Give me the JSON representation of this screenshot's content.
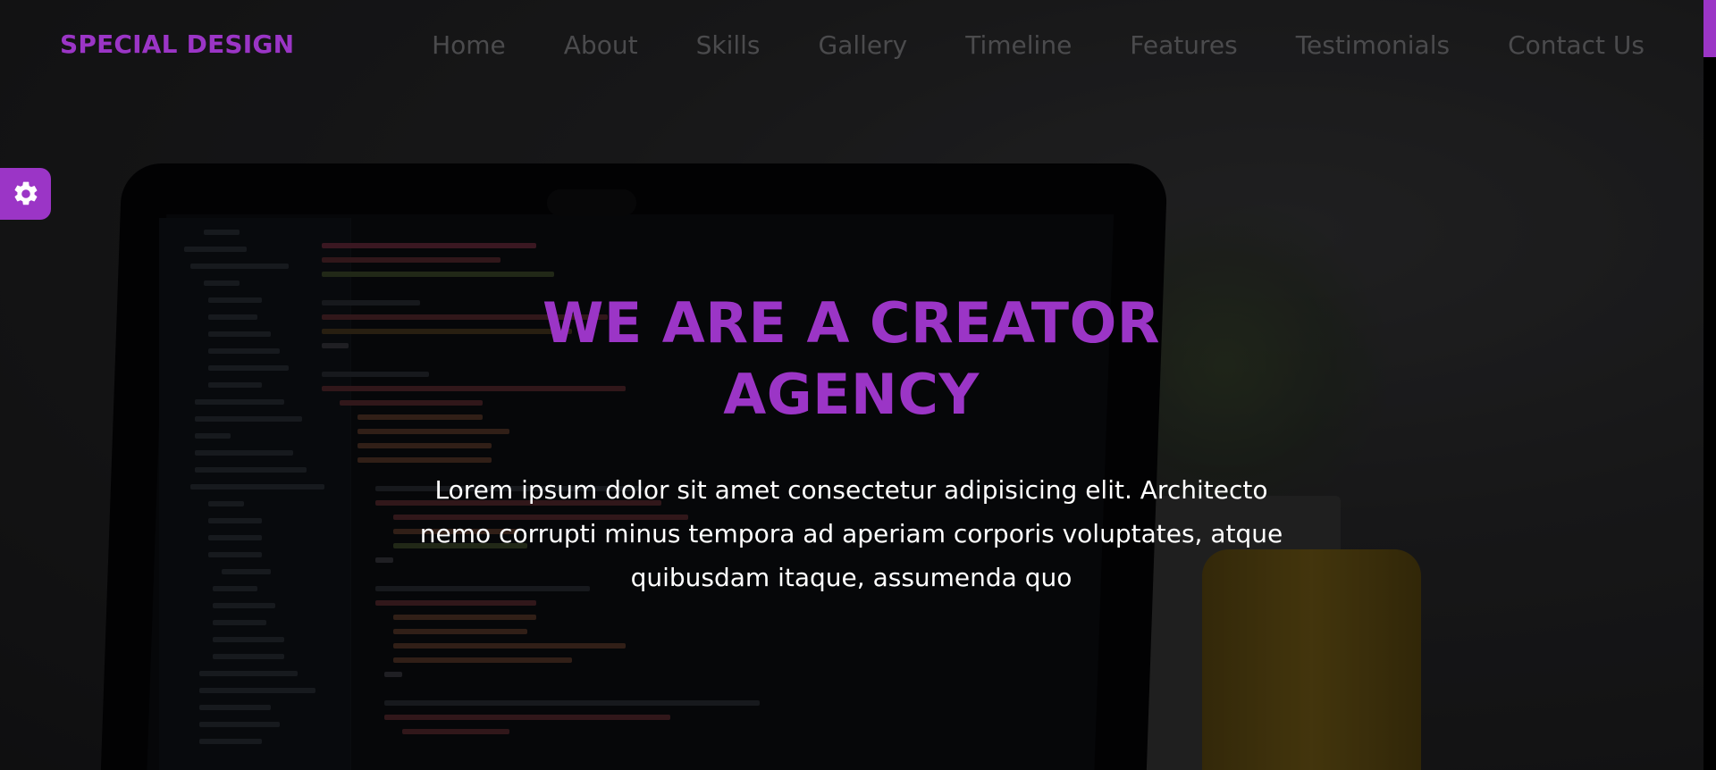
{
  "header": {
    "logo": "SPECIAL DESIGN",
    "nav": [
      "Home",
      "About",
      "Skills",
      "Gallery",
      "Timeline",
      "Features",
      "Testimonials",
      "Contact Us"
    ]
  },
  "settings": {
    "icon": "gear-icon"
  },
  "hero": {
    "title": "WE ARE A CREATOR AGENCY",
    "text": "Lorem ipsum dolor sit amet consectetur adipisicing elit. Architecto nemo corrupti minus tempora ad aperiam corporis voluptates, atque quibusdam itaque, assumenda quo"
  },
  "colors": {
    "accent": "#9b35c6",
    "nav_text": "#4b4b4d",
    "hero_text": "#ffffff"
  }
}
